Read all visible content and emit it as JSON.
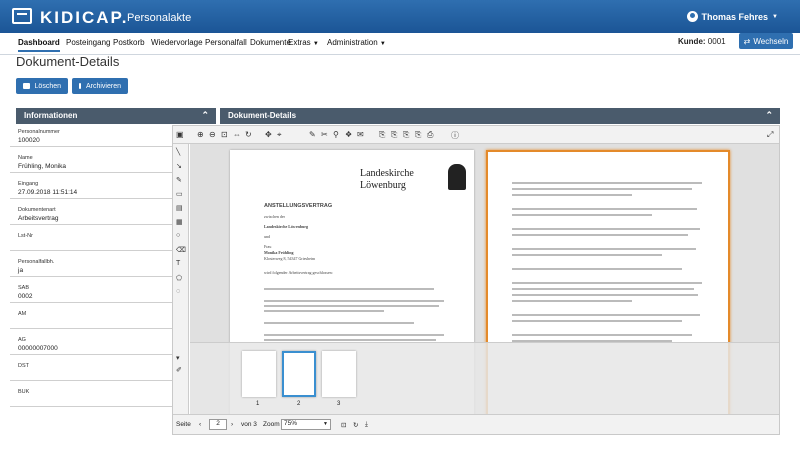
{
  "header": {
    "brand": "KIDICAP.",
    "subtitle": "Personalakte",
    "user": "Thomas Fehres"
  },
  "nav": {
    "items": [
      {
        "label": "Dashboard"
      },
      {
        "label": "Posteingang"
      },
      {
        "label": "Postkorb"
      },
      {
        "label": "Wiedervorlage"
      },
      {
        "label": "Personalfall"
      },
      {
        "label": "Dokumente"
      },
      {
        "label": "Extras"
      },
      {
        "label": "Administration"
      }
    ],
    "kunde_label": "Kunde:",
    "kunde_value": "0001",
    "wechseln": "Wechseln"
  },
  "page": {
    "title": "Dokument-Details"
  },
  "actions": {
    "delete": "Löschen",
    "archive": "Archivieren"
  },
  "panels": {
    "info": "Informationen",
    "details": "Dokument-Details"
  },
  "fields": [
    {
      "label": "Personalnummer",
      "value": "100020"
    },
    {
      "label": "Name",
      "value": "Frühling, Monika"
    },
    {
      "label": "Eingang",
      "value": "27.09.2018 11:51:14"
    },
    {
      "label": "Dokumentenart",
      "value": "Arbeitsvertrag"
    },
    {
      "label": "Lst-Nr",
      "value": ""
    },
    {
      "label": "Personalfallbh.",
      "value": "ja"
    },
    {
      "label": "SAB",
      "value": "0002"
    },
    {
      "label": "AM",
      "value": ""
    },
    {
      "label": "AG",
      "value": "00000007000"
    },
    {
      "label": "DST",
      "value": ""
    },
    {
      "label": "BUK",
      "value": ""
    }
  ],
  "doc": {
    "org1": "Landeskirche",
    "org2": "Löwenburg",
    "heading": "ANSTELLUNGSVERTRAG",
    "between": "zwischen der",
    "party1": "Landeskirche Löwenburg",
    "and": "und",
    "frau": "Frau",
    "person": "Monika Frühling",
    "street": "Klosterweg 8, 54347 Griesheim",
    "closing": "wird folgender Arbeitsvertrag geschlossen:"
  },
  "viewer": {
    "page_label": "Seite",
    "page_value": "2",
    "of_label": "von 3",
    "zoom_label": "Zoom",
    "zoom_value": "75%",
    "thumb_nums": [
      "1",
      "2",
      "3"
    ]
  }
}
